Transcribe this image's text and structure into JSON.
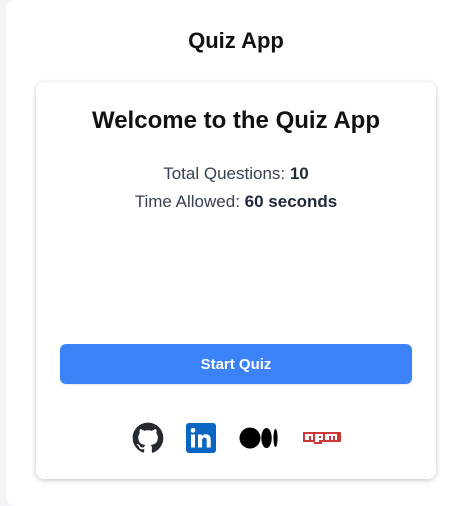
{
  "app": {
    "title": "Quiz App"
  },
  "welcome": {
    "heading": "Welcome to the Quiz App",
    "total_questions_label": "Total Questions: ",
    "total_questions_value": "10",
    "time_allowed_label": "Time Allowed: ",
    "time_allowed_value": "60 seconds"
  },
  "actions": {
    "start_label": "Start Quiz"
  },
  "colors": {
    "primary_button": "#3b82f6",
    "github": "#24292f",
    "linkedin": "#0a66c2",
    "medium": "#000000",
    "npm": "#cb3837"
  },
  "social_links": [
    {
      "icon": "github-icon"
    },
    {
      "icon": "linkedin-icon"
    },
    {
      "icon": "medium-icon"
    },
    {
      "icon": "npm-icon"
    }
  ]
}
